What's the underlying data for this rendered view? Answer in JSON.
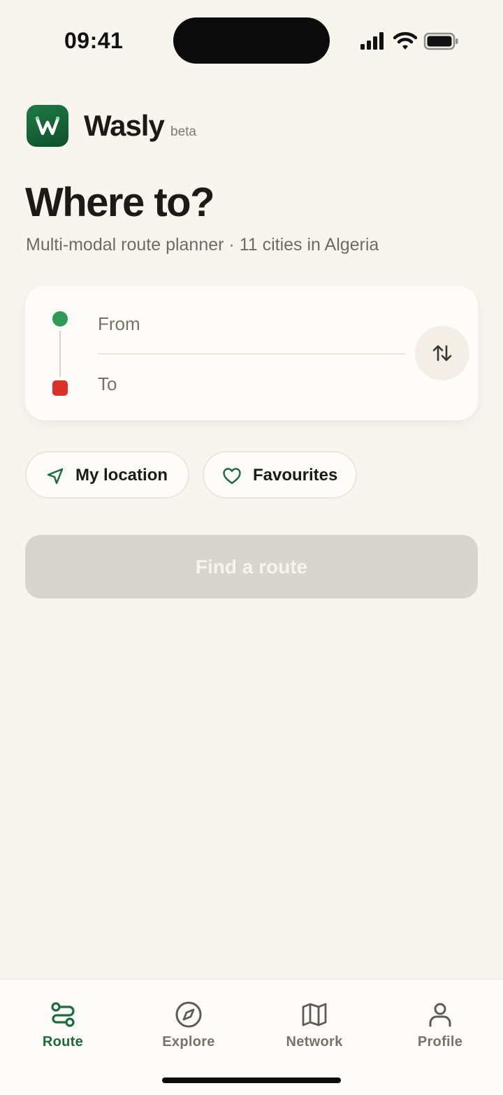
{
  "status_bar": {
    "time": "09:41",
    "icons": [
      "signal-icon",
      "wifi-icon",
      "battery-icon"
    ]
  },
  "header": {
    "logo_icon": "wasly-logo-icon",
    "app_name": "Wasly",
    "badge": "beta"
  },
  "main": {
    "title": "Where to?",
    "subtitle": "Multi-modal route planner · 11 cities in Algeria"
  },
  "route_form": {
    "from_placeholder": "From",
    "from_value": "",
    "to_placeholder": "To",
    "to_value": "",
    "swap_icon": "swap-vertical-icon"
  },
  "quick_actions": [
    {
      "label": "My location",
      "icon": "navigation-arrow-icon"
    },
    {
      "label": "Favourites",
      "icon": "heart-icon"
    }
  ],
  "find_button": {
    "label": "Find a route",
    "state": "disabled"
  },
  "tabs": [
    {
      "label": "Route",
      "icon": "route-icon",
      "active": true
    },
    {
      "label": "Explore",
      "icon": "compass-icon",
      "active": false
    },
    {
      "label": "Network",
      "icon": "map-icon",
      "active": false
    },
    {
      "label": "Profile",
      "icon": "person-icon",
      "active": false
    }
  ],
  "colors": {
    "background": "#f8f5ef",
    "brand_green": "#1c6b3c",
    "origin_green": "#2e9a57",
    "destination_red": "#dc2f2a",
    "disabled_button": "#d8d4ce",
    "inactive_tab": "#77726b"
  }
}
